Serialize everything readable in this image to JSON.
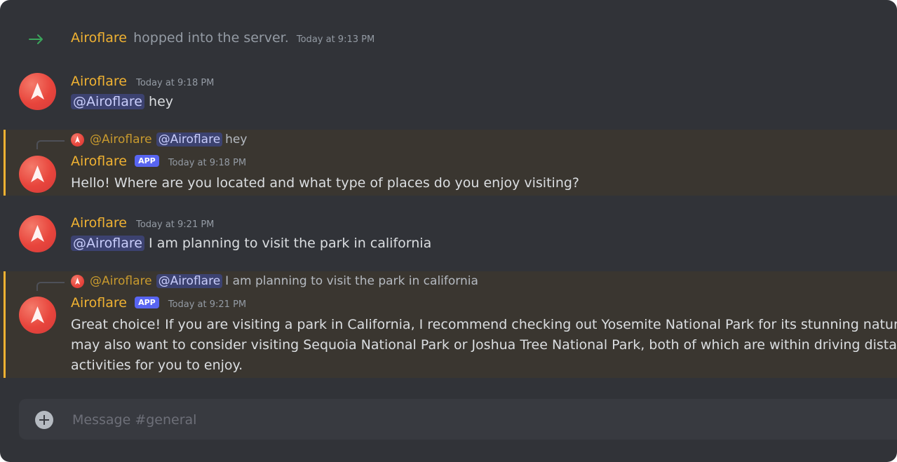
{
  "system_message": {
    "username": "Airoflare",
    "text": "hopped into the server.",
    "timestamp": "Today at 9:13 PM"
  },
  "messages": [
    {
      "username": "Airoflare",
      "timestamp": "Today at 9:18 PM",
      "mention": "@Airoflare",
      "text": "hey"
    },
    {
      "reply": {
        "author": "@Airoflare",
        "mention": "@Airoflare",
        "text": "hey"
      },
      "username": "Airoflare",
      "badge": "APP",
      "timestamp": "Today at 9:18 PM",
      "text": "Hello! Where are you located and what type of places do you enjoy visiting?"
    },
    {
      "username": "Airoflare",
      "timestamp": "Today at 9:21 PM",
      "mention": "@Airoflare",
      "text": "I am planning to visit the park in california"
    },
    {
      "reply": {
        "author": "@Airoflare",
        "mention": "@Airoflare",
        "text": "I am planning to visit the park in california"
      },
      "username": "Airoflare",
      "badge": "APP",
      "timestamp": "Today at 9:21 PM",
      "lines": [
        "Great choice! If you are visiting a park in California, I recommend checking out Yosemite National Park for its stunning natural beaut",
        "may also want to consider visiting Sequoia National Park or Joshua Tree National Park, both of which are within driving distance fro",
        "activities for you to enjoy."
      ]
    }
  ],
  "composer": {
    "placeholder": "Message #general"
  },
  "colors": {
    "background": "#313338",
    "username": "#f0b232",
    "mention_bg": "#3c4270",
    "app_badge": "#5865f2",
    "join_arrow": "#3ba55c",
    "reply_highlight": "#3a3630"
  }
}
